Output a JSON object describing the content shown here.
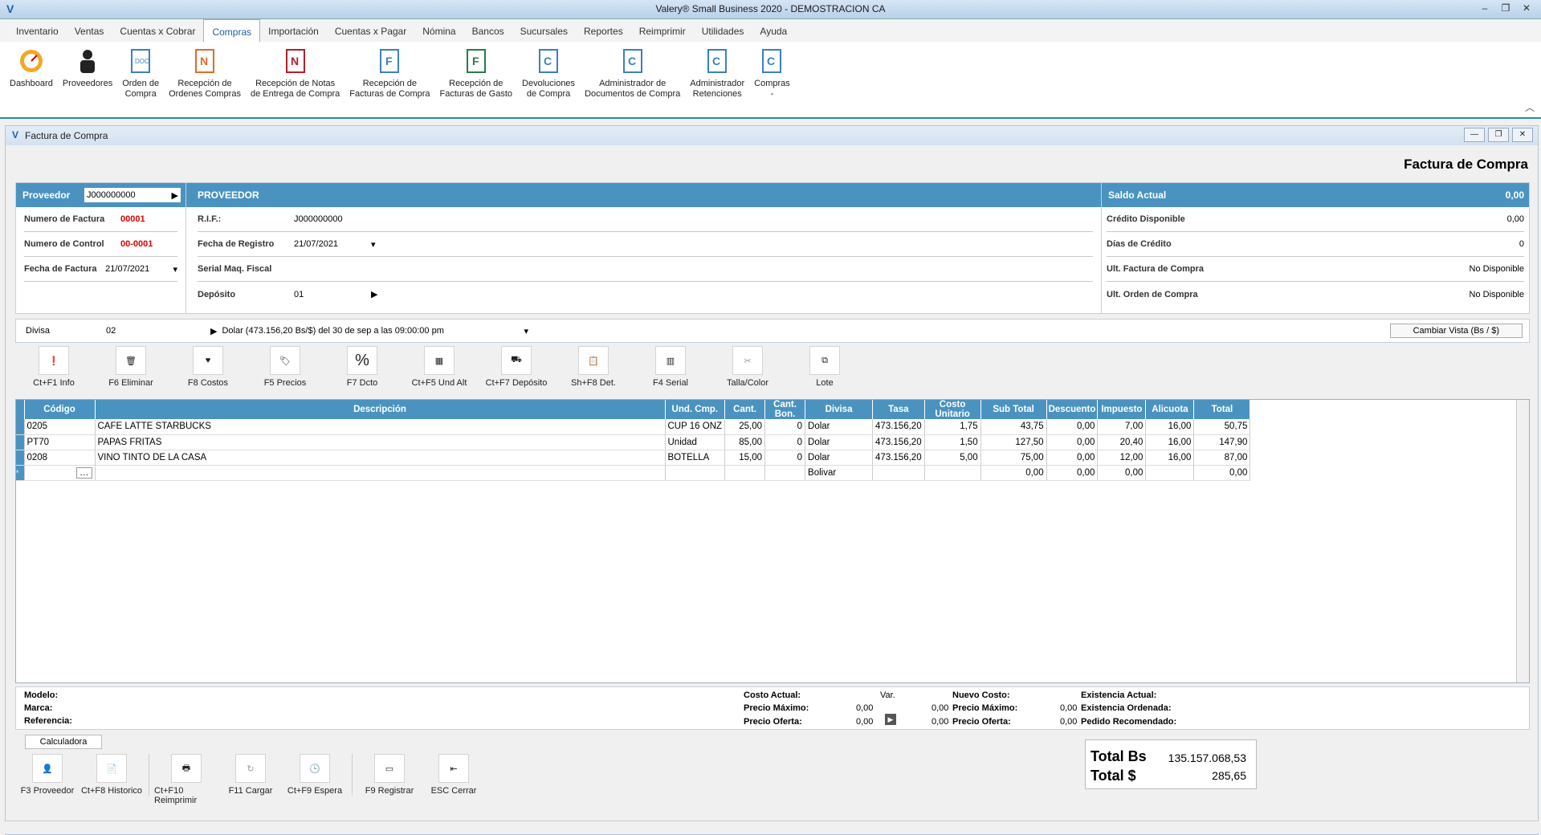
{
  "window": {
    "title": "Valery® Small Business 2020 - DEMOSTRACION CA"
  },
  "menu": [
    "Inventario",
    "Ventas",
    "Cuentas x Cobrar",
    "Compras",
    "Importación",
    "Cuentas x Pagar",
    "Nómina",
    "Bancos",
    "Sucursales",
    "Reportes",
    "Reimprimir",
    "Utilidades",
    "Ayuda"
  ],
  "ribbon": [
    {
      "l1": "Dashboard",
      "l2": "",
      "icon": "gauge-icon"
    },
    {
      "l1": "Proveedores",
      "l2": "",
      "icon": "person-icon"
    },
    {
      "l1": "Orden de",
      "l2": "Compra",
      "icon": "doc-icon"
    },
    {
      "l1": "Recepción de",
      "l2": "Ordenes Compras",
      "icon": "doc-n-icon"
    },
    {
      "l1": "Recepción de Notas",
      "l2": "de Entrega de Compra",
      "icon": "doc-n-icon"
    },
    {
      "l1": "Recepción de",
      "l2": "Facturas de Compra",
      "icon": "doc-f-icon"
    },
    {
      "l1": "Recepción de",
      "l2": "Facturas de Gasto",
      "icon": "doc-f-icon"
    },
    {
      "l1": "Devoluciones",
      "l2": "de Compra",
      "icon": "doc-c-icon"
    },
    {
      "l1": "Administrador de",
      "l2": "Documentos de Compra",
      "icon": "doc-c-icon"
    },
    {
      "l1": "Administrador",
      "l2": "Retenciones",
      "icon": "doc-c-icon"
    },
    {
      "l1": "Compras",
      "l2": "-",
      "icon": "doc-c-icon"
    }
  ],
  "doc": {
    "title": "Factura de Compra",
    "heading": "Factura de Compra"
  },
  "left": {
    "proveedor_label": "Proveedor",
    "proveedor_value": "J000000000",
    "numfact_label": "Numero de Factura",
    "numfact_value": "00001",
    "numctrl_label": "Numero de Control",
    "numctrl_value": "00-0001",
    "fechafact_label": "Fecha de Factura",
    "fechafact_value": "21/07/2021"
  },
  "mid": {
    "header": "PROVEEDOR",
    "rif_label": "R.I.F.:",
    "rif_value": "J000000000",
    "fechareg_label": "Fecha de Registro",
    "fechareg_value": "21/07/2021",
    "serial_label": "Serial Maq. Fiscal",
    "serial_value": "",
    "deposito_label": "Depósito",
    "deposito_value": "01"
  },
  "right": {
    "saldo_label": "Saldo Actual",
    "saldo_value": "0,00",
    "credito_label": "Crédito Disponible",
    "credito_value": "0,00",
    "dias_label": "Días de Crédito",
    "dias_value": "0",
    "ultfact_label": "Ult. Factura de Compra",
    "ultfact_value": "No Disponible",
    "ultorden_label": "Ult. Orden de Compra",
    "ultorden_value": "No Disponible"
  },
  "divisa": {
    "label": "Divisa",
    "code": "02",
    "desc": "Dolar (473.156,20 Bs/$) del 30 de sep a las 09:00:00 pm",
    "button": "Cambiar Vista (Bs / $)"
  },
  "toolbar": [
    "Ct+F1 Info",
    "F6 Eliminar",
    "F8 Costos",
    "F5 Precios",
    "F7 Dcto",
    "Ct+F5 Und Alt",
    "Ct+F7 Depósito",
    "Sh+F8 Det.",
    "F4 Serial",
    "Talla/Color",
    "Lote"
  ],
  "grid": {
    "columns": [
      "Código",
      "Descripción",
      "Und. Cmp.",
      "Cant.",
      "Cant. Bon.",
      "Divisa",
      "Tasa",
      "Costo Unitario",
      "Sub Total",
      "Descuento",
      "Impuesto",
      "Alicuota",
      "Total"
    ],
    "rows": [
      [
        "0205",
        "CAFE LATTE STARBUCKS",
        "CUP 16 ONZ",
        "25,00",
        "0",
        "Dolar",
        "473.156,20",
        "1,75",
        "43,75",
        "0,00",
        "7,00",
        "16,00",
        "50,75"
      ],
      [
        "PT70",
        "PAPAS FRITAS",
        "Unidad",
        "85,00",
        "0",
        "Dolar",
        "473.156,20",
        "1,50",
        "127,50",
        "0,00",
        "20,40",
        "16,00",
        "147,90"
      ],
      [
        "0208",
        "VINO TINTO DE LA CASA",
        "BOTELLA",
        "15,00",
        "0",
        "Dolar",
        "473.156,20",
        "5,00",
        "75,00",
        "0,00",
        "12,00",
        "16,00",
        "87,00"
      ],
      [
        "",
        "",
        "",
        "",
        "",
        "Bolivar",
        "",
        "",
        "0,00",
        "0,00",
        "0,00",
        "",
        "0,00"
      ]
    ]
  },
  "detail": {
    "modelo": "Modelo:",
    "marca": "Marca:",
    "referencia": "Referencia:",
    "costo_actual": "Costo Actual:",
    "var": "Var.",
    "nuevo_costo": "Nuevo Costo:",
    "existencia_actual": "Existencia Actual:",
    "precio_max": "Precio Máximo:",
    "precio_max_v1": "0,00",
    "precio_max_v2": "0,00",
    "precio_max2": "Precio Máximo:",
    "precio_max_v3": "0,00",
    "existencia_ord": "Existencia Ordenada:",
    "precio_oferta": "Precio Oferta:",
    "precio_oferta_v1": "0,00",
    "precio_oferta_v2": "0,00",
    "precio_oferta2": "Precio Oferta:",
    "precio_oferta_v3": "0,00",
    "pedido": "Pedido Recomendado:"
  },
  "calc": "Calculadora",
  "bottom": [
    "F3 Proveedor",
    "Ct+F8 Historico",
    "Ct+F10 Reimprimir",
    "F11 Cargar",
    "Ct+F9 Espera",
    "F9 Registrar",
    "ESC Cerrar"
  ],
  "totals": {
    "bs_label": "Total Bs",
    "bs_value": "135.157.068,53",
    "usd_label": "Total $",
    "usd_value": "285,65"
  }
}
